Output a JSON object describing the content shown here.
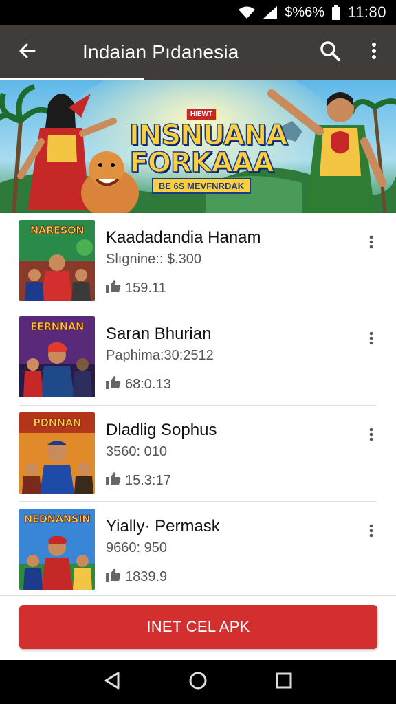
{
  "status_bar": {
    "battery_text": "$%6%",
    "time": "11:80",
    "icons": [
      "wifi-icon",
      "cell-signal-icon",
      "battery-icon"
    ]
  },
  "app_bar": {
    "title": "Indaian Pıdanesia",
    "icons": [
      "back-arrow-icon",
      "search-icon",
      "more-vert-icon"
    ]
  },
  "banner": {
    "badge": "HIEWT",
    "title_line1": "INSNUANA",
    "title_line2": "FORKAAA",
    "tagline": "BE 6S MEVFNRDAK"
  },
  "items": [
    {
      "name": "Kaadadandia Hanam",
      "subtitle": "Slıgnine:: $.300",
      "count": "159.11",
      "thumb_title": "NARESON",
      "thumb_colors": [
        "#1f7a3a",
        "#e0503a"
      ]
    },
    {
      "name": "Saran Bhurian",
      "subtitle": "Paphima:30:2512",
      "count": "68:0.13",
      "thumb_title": "EERNNAN",
      "thumb_colors": [
        "#6a2a8a",
        "#e23b3b"
      ]
    },
    {
      "name": "Dladlig Sophus",
      "subtitle": "3560: 010",
      "count": "15.3:17",
      "thumb_title": "PDNNAN",
      "thumb_colors": [
        "#c13a1a",
        "#f0b429"
      ]
    },
    {
      "name": "Yially· Permask",
      "subtitle": "9660: 950",
      "count": "1839.9",
      "thumb_title": "NEDNANSIN",
      "thumb_colors": [
        "#2c6fbf",
        "#d8342c"
      ]
    }
  ],
  "cta": {
    "label": "INET CEL APK"
  },
  "nav_bar": {
    "icons": [
      "back-triangle-icon",
      "home-circle-icon",
      "recents-square-icon"
    ]
  },
  "colors": {
    "app_bar": "#3f3c3a",
    "accent": "#d32f2f",
    "background": "#ffffff"
  }
}
